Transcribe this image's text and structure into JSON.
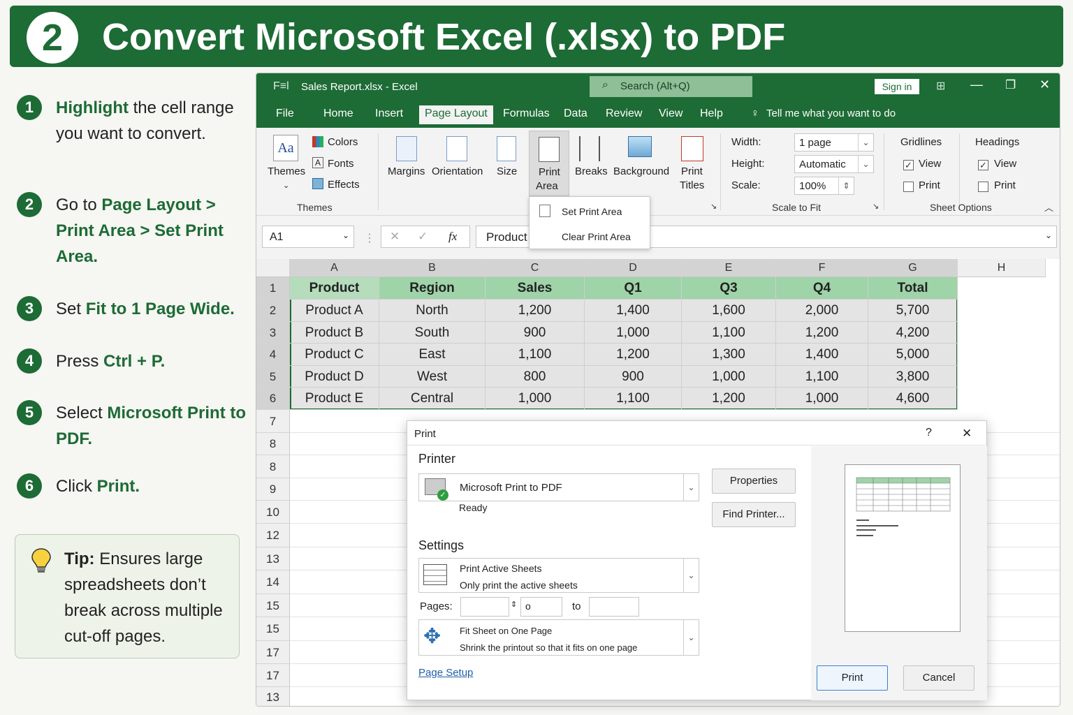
{
  "banner": {
    "number": "2",
    "title": "Convert Microsoft Excel (.xlsx) to PDF"
  },
  "steps": [
    {
      "num": "1",
      "bold1": "Highlight",
      "text1": " the cell range you want to convert."
    },
    {
      "num": "2",
      "text1": "Go to ",
      "bold1": "Page Layout > Print Area > Set Print Area."
    },
    {
      "num": "3",
      "text1": "Set ",
      "bold1": "Fit to 1 Page Wide."
    },
    {
      "num": "4",
      "text1": "Press ",
      "bold1": "Ctrl + P."
    },
    {
      "num": "5",
      "text1": "Select ",
      "bold1": "Microsoft Print to PDF."
    },
    {
      "num": "6",
      "text1": "Click ",
      "bold1": "Print."
    }
  ],
  "tip": {
    "bold": "Tip:",
    "text": " Ensures large spreadsheets don’t break across multiple cut-off pages."
  },
  "excel": {
    "titlebar": {
      "logo": "F≡l",
      "title": "Sales Report.xlsx - Excel",
      "search": "Search (Alt+Q)",
      "signin": "Sign in"
    },
    "tabs": [
      "File",
      "Home",
      "Insert",
      "Page Layout",
      "Formulas",
      "Data",
      "Review",
      "View",
      "Help"
    ],
    "tell_me": "Tell me what you want to do",
    "themes_group": {
      "themes": "Themes",
      "colors": "Colors",
      "fonts": "Fonts",
      "effects": "Effects",
      "label": "Themes"
    },
    "page_setup": {
      "margins": "Margins",
      "orientation": "Orientation",
      "size": "Size",
      "print_area": "Print",
      "print_area2": "Area",
      "breaks": "Breaks",
      "background": "Background",
      "print_titles": "Print",
      "print_titles2": "Titles"
    },
    "print_area_menu": [
      "Set Print Area",
      "Clear Print Area"
    ],
    "scale_to_fit": {
      "width_label": "Width:",
      "width": "1 page",
      "height_label": "Height:",
      "height": "Automatic",
      "scale_label": "Scale:",
      "scale": "100%",
      "label": "Scale to Fit"
    },
    "sheet_options": {
      "gridlines": "Gridlines",
      "headings": "Headings",
      "view": "View",
      "print": "Print",
      "label": "Sheet Options"
    },
    "formula_bar": {
      "namebox": "A1",
      "fx": "fx",
      "content": "Product"
    },
    "columns": [
      "A",
      "B",
      "C",
      "D",
      "E",
      "F",
      "G",
      "H"
    ],
    "row_numbers": [
      "1",
      "2",
      "3",
      "4",
      "5",
      "6",
      "7",
      "8",
      "8",
      "9",
      "10",
      "12",
      "13",
      "14",
      "15",
      "15",
      "17",
      "17",
      "13"
    ],
    "header_row": [
      "Product",
      "Region",
      "Sales",
      "Q1",
      "Q3",
      "Q4",
      "Total"
    ],
    "rows": [
      [
        "Product A",
        "North",
        "1,200",
        "1,400",
        "1,600",
        "2,000",
        "5,700"
      ],
      [
        "Product B",
        "South",
        "900",
        "1,000",
        "1,100",
        "1,200",
        "4,200"
      ],
      [
        "Product C",
        "East",
        "1,100",
        "1,200",
        "1,300",
        "1,400",
        "5,000"
      ],
      [
        "Product D",
        "West",
        "800",
        "900",
        "1,000",
        "1,100",
        "3,800"
      ],
      [
        "Product E",
        "Central",
        "1,000",
        "1,100",
        "1,200",
        "1,000",
        "4,600"
      ]
    ]
  },
  "print_dialog": {
    "title": "Print",
    "help": "?",
    "close": "✕",
    "printer_heading": "Printer",
    "printer_name": "Microsoft Print to PDF",
    "printer_status": "Ready",
    "properties": "Properties",
    "find_printer": "Find Printer...",
    "settings_heading": "Settings",
    "setting1_title": "Print Active Sheets",
    "setting1_sub": "Only print the active sheets",
    "pages_label": "Pages:",
    "pages_from": "o",
    "to_label": "to",
    "setting2_title": "Fit Sheet on One Page",
    "setting2_sub": "Shrink the printout so that it fits on one page",
    "page_setup_link": "Page Setup",
    "print_button": "Print",
    "cancel_button": "Cancel"
  },
  "colors": {
    "brand": "#1d6b35",
    "header_fill": "#9fd3a8"
  }
}
